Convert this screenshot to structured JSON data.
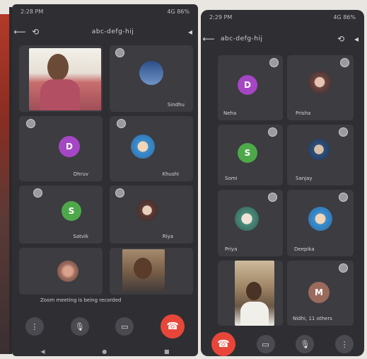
{
  "left": {
    "status_left": "2:28 PM",
    "status_right": "4G 86%",
    "title": "abc-defg-hij",
    "tiles": [
      {
        "name": "Sindhu"
      },
      {
        "name": "Dhruv",
        "initial": "D"
      },
      {
        "name": "Khushi"
      },
      {
        "name": "Satvik",
        "initial": "S"
      },
      {
        "name": "Riya"
      }
    ],
    "caption": "Zoom meeting is being recorded",
    "nav": [
      "◀",
      "●",
      "■"
    ]
  },
  "right": {
    "status_left": "2:29 PM",
    "status_right": "4G 86%",
    "title": "abc-defg-hij",
    "tiles": [
      {
        "name": "Neha",
        "initial": "D"
      },
      {
        "name": "Prisha"
      },
      {
        "name": "Somi",
        "initial": "S"
      },
      {
        "name": "Sanjay"
      },
      {
        "name": "Priya"
      },
      {
        "name": "Deepika"
      },
      {
        "name": "Nidhi, 11 others",
        "initial": "M"
      }
    ]
  },
  "colors": {
    "end_call": "#e9463a",
    "purple": "#a546c4",
    "green": "#4ea84a",
    "brown": "#9a6a5c"
  }
}
